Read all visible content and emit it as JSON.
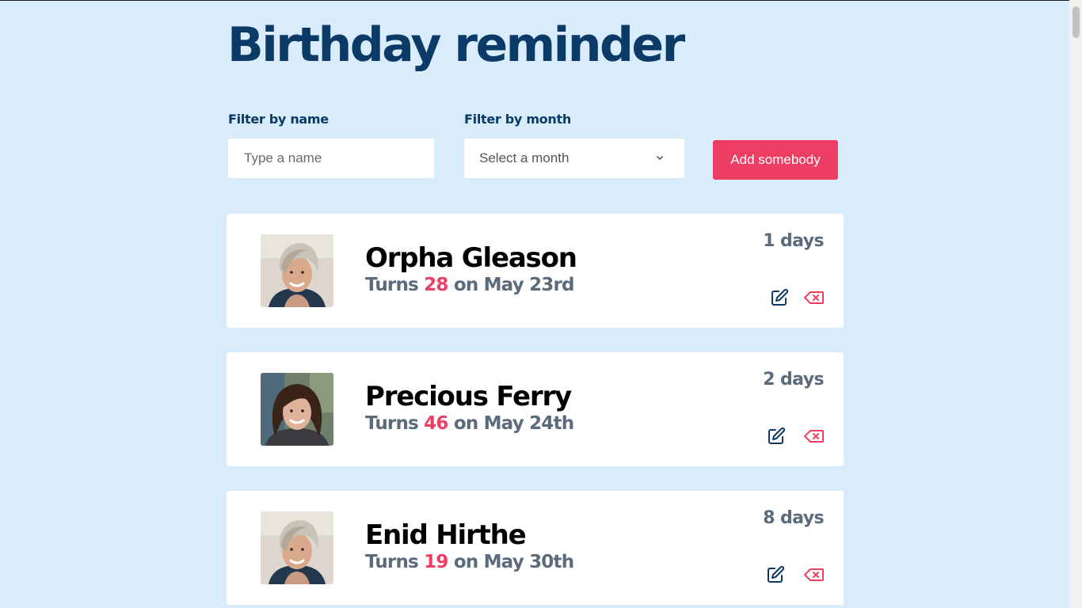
{
  "app": {
    "title": "Birthday reminder"
  },
  "filters": {
    "name_label": "Filter by name",
    "name_placeholder": "Type a name",
    "month_label": "Filter by month",
    "month_selected": "Select a month"
  },
  "actions": {
    "add_label": "Add somebody"
  },
  "colors": {
    "background": "#d8ecfc",
    "title": "#0c3a66",
    "accent": "#ef3e63",
    "muted": "#5b6b7c"
  },
  "people": [
    {
      "name": "Orpha Gleason",
      "turns_prefix": "Turns",
      "age": "28",
      "date_text": "on May 23rd",
      "days": "1 days",
      "avatar": "short-hair-woman-avatar"
    },
    {
      "name": "Precious Ferry",
      "turns_prefix": "Turns",
      "age": "46",
      "date_text": "on May 24th",
      "days": "2 days",
      "avatar": "long-hair-woman-avatar"
    },
    {
      "name": "Enid Hirthe",
      "turns_prefix": "Turns",
      "age": "19",
      "date_text": "on May 30th",
      "days": "8 days",
      "avatar": "short-hair-woman-avatar"
    }
  ]
}
